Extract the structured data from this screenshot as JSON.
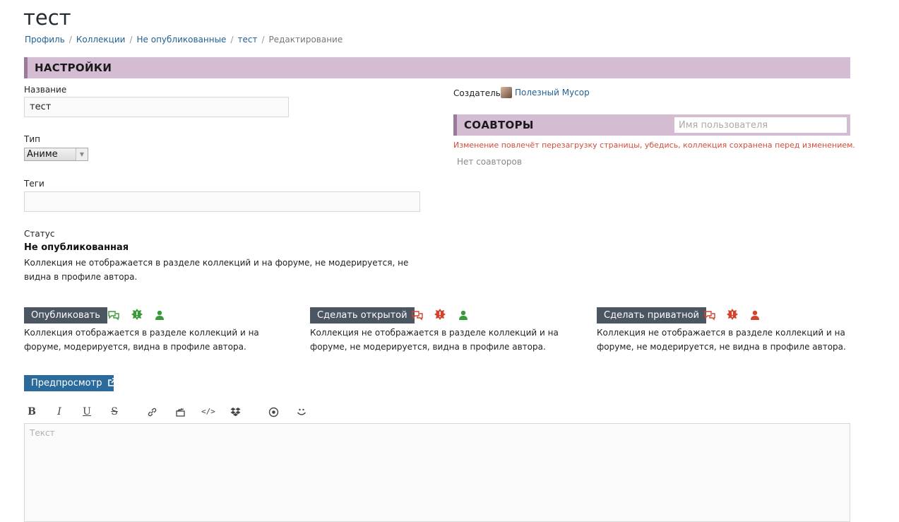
{
  "page_title": "тест",
  "breadcrumb": {
    "items": [
      "Профиль",
      "Коллекции",
      "Не опубликованные",
      "тест"
    ],
    "separator": "/",
    "current": "Редактирование"
  },
  "settings": {
    "section_title": "НАСТРОЙКИ",
    "name_label": "Название",
    "name_value": "тест",
    "type_label": "Тип",
    "type_value": "Аниме",
    "tags_label": "Теги",
    "tags_value": "",
    "status_label": "Статус",
    "status_value": "Не опубликованная",
    "status_desc": "Коллекция не отображается в разделе коллекций и на форуме, не модерируется, не видна в профиле автора."
  },
  "creator": {
    "label": "Создатель",
    "name": "Полезный Мусор"
  },
  "coauthors": {
    "section_title": "СОАВТОРЫ",
    "search_placeholder": "Имя пользователя",
    "warning": "Изменение повлечёт перезагрузку страницы, убедись, коллекция сохранена перед изменением.",
    "empty_text": "Нет соавторов"
  },
  "actions": [
    {
      "label": "Опубликовать",
      "desc": "Коллекция отображается в разделе коллекций и на форуме, модерируется, видна в профиле автора.",
      "icon_color": "#3a9a3a"
    },
    {
      "label": "Сделать открытой",
      "desc": "Коллекция не отображается в разделе коллекций и на форуме, не модерируется, видна в профиле автора.",
      "icon_color": "#d4432c"
    },
    {
      "label": "Сделать приватной",
      "desc": "Коллекция не отображается в разделе коллекций и на форуме, не модерируется, не видна в профиле автора.",
      "icon_color": "#d4432c"
    }
  ],
  "action_icons": [
    "comments-icon",
    "moderation-badge-icon",
    "user-icon"
  ],
  "preview_button": "Предпросмотр",
  "editor": {
    "toolbar": [
      "bold-icon",
      "italic-icon",
      "underline-icon",
      "strikethrough-icon",
      "link-icon",
      "video-icon",
      "code-icon",
      "dropbox-icon",
      "spoiler-icon",
      "smiley-icon"
    ],
    "placeholder": "Текст"
  },
  "colors": {
    "section_bar": "#d4bdd2",
    "section_bar_border": "#9a7b9a",
    "link": "#1e5f95",
    "button_dark": "#4b5662",
    "button_blue": "#2b6b9b",
    "warning": "#d44c3c"
  }
}
